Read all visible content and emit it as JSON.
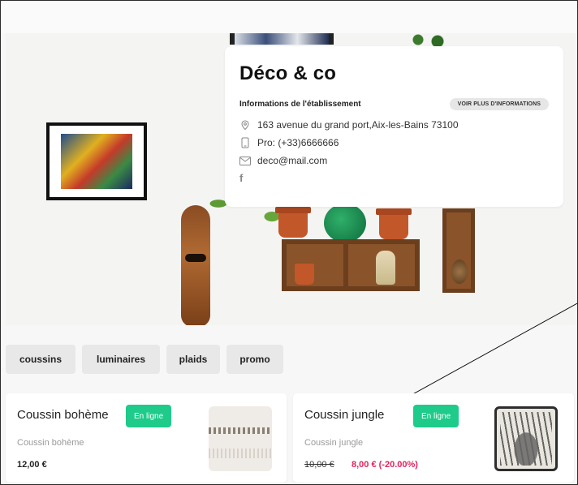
{
  "store": {
    "name": "Déco & co",
    "info_label": "Informations de l'établissement",
    "more_button": "VOIR PLUS D'INFORMATIONS",
    "address": "163 avenue du grand port,Aix-les-Bains 73100",
    "phone": "Pro: (+33)6666666",
    "email": "deco@mail.com",
    "social_icon": "f"
  },
  "icons": {
    "address": "location-pin-icon",
    "phone": "phone-icon",
    "email": "mail-icon",
    "social": "facebook-icon"
  },
  "categories": [
    "coussins",
    "luminaires",
    "plaids",
    "promo"
  ],
  "products": [
    {
      "name": "Coussin bohème",
      "badge": "En ligne",
      "subtitle": "Coussin bohème",
      "price": "12,00 €"
    },
    {
      "name": "Coussin jungle",
      "badge": "En ligne",
      "subtitle": "Coussin jungle",
      "old_price": "10,00 €",
      "new_price": "8,00 € (-20.00%)"
    }
  ],
  "colors": {
    "badge": "#1ecb8a",
    "sale_price": "#e0245e",
    "chip_bg": "#e8e8e8"
  }
}
